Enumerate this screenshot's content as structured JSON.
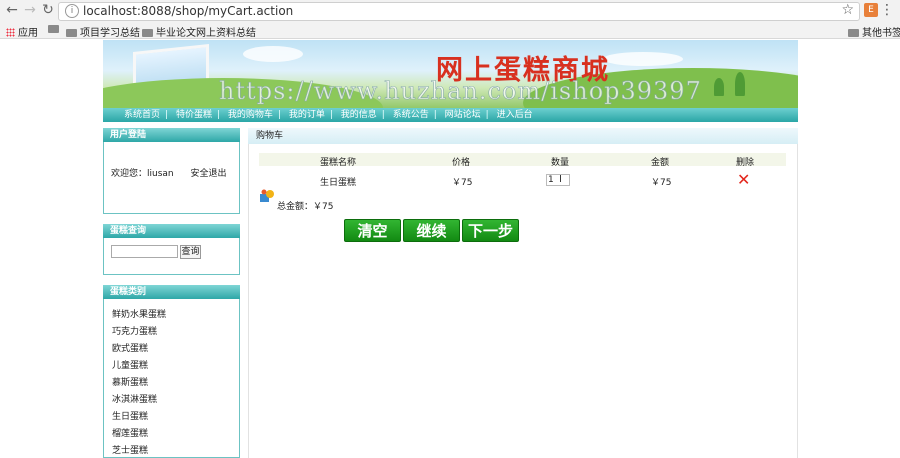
{
  "browser": {
    "url": "localhost:8088/shop/myCart.action",
    "bookmarks": [
      "应用",
      "项目学习总结",
      "毕业论文网上资料总结",
      "其他书签"
    ]
  },
  "site": {
    "title": "网上蛋糕商城",
    "watermark": "https://www.huzhan.com/ishop39397",
    "nav": [
      "系统首页",
      "特价蛋糕",
      "我的购物车",
      "我的订单",
      "我的信息",
      "系统公告",
      "网站论坛",
      "进入后台"
    ],
    "nav_sep": "|"
  },
  "sidebar": {
    "login": {
      "title": "用户登陆",
      "welcome": "欢迎您：liusan",
      "logout": "安全退出"
    },
    "search": {
      "title": "蛋糕查询",
      "button": "查询"
    },
    "categories": {
      "title": "蛋糕类别",
      "items": [
        "鲜奶水果蛋糕",
        "巧克力蛋糕",
        "欧式蛋糕",
        "儿童蛋糕",
        "慕斯蛋糕",
        "冰淇淋蛋糕",
        "生日蛋糕",
        "榴莲蛋糕",
        "芝士蛋糕"
      ]
    }
  },
  "cart": {
    "title": "购物车",
    "columns": [
      "蛋糕名称",
      "价格",
      "数量",
      "金额",
      "删除"
    ],
    "rows": [
      {
        "name": "生日蛋糕",
        "price": "￥75",
        "qty": "1",
        "amount": "￥75"
      }
    ],
    "total": "总金额：￥75",
    "buttons": {
      "clear": "清空",
      "continue": "继续",
      "next": "下一步"
    }
  },
  "colors": {
    "nav": "#2aa6a6",
    "title": "#d8301f",
    "button": "#1f9e1f",
    "delete": "#e3261c"
  }
}
